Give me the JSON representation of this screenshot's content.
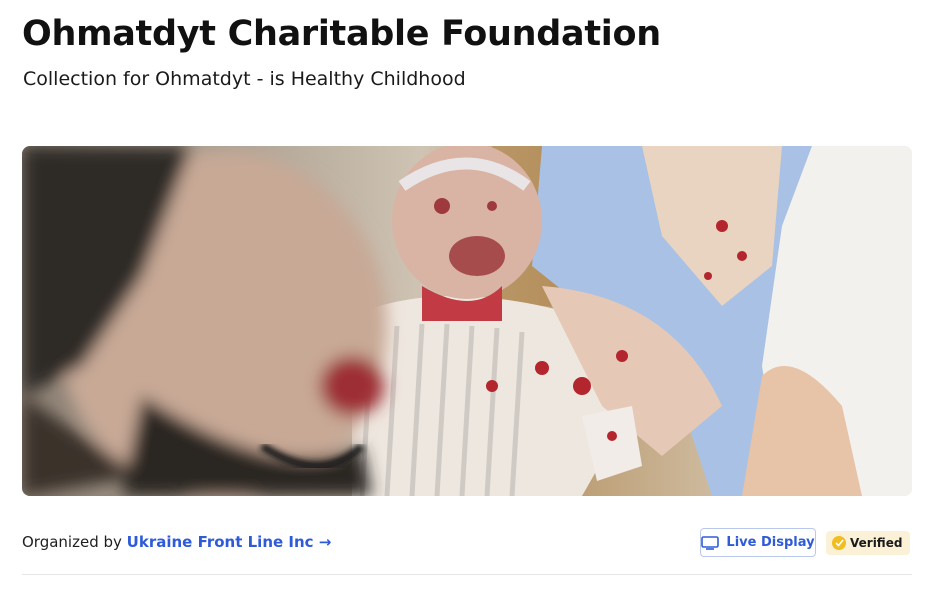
{
  "page": {
    "title": "Ohmatdyt Charitable Foundation",
    "subtitle": "Collection for Ohmatdyt - is Healthy Childhood"
  },
  "organizer": {
    "prefix": "Organized by",
    "name": "Ukraine Front Line Inc",
    "arrow": "→"
  },
  "actions": {
    "live_display_label": "Live Display",
    "verified_label": "Verified"
  },
  "colors": {
    "link": "#2f5bd8",
    "verified_bg": "#fbf1d6",
    "verified_check": "#f2bd1f"
  },
  "icons": {
    "live_display": "monitor-icon",
    "verified": "check-circle-icon",
    "organizer_link": "arrow-right-icon"
  }
}
